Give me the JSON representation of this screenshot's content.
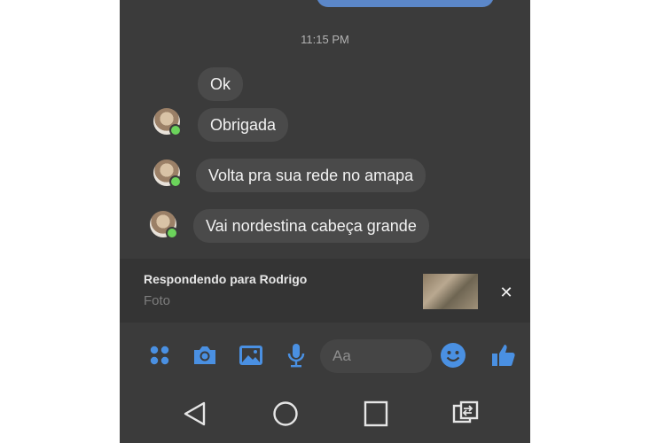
{
  "chat": {
    "timestamp": "11:15 PM",
    "messages": [
      {
        "text": "Ok"
      },
      {
        "text": "Obrigada"
      },
      {
        "text": "Volta pra sua rede no amapa"
      },
      {
        "text": "Vai nordestina cabeça grande"
      }
    ]
  },
  "reply": {
    "title": "Respondendo para Rodrigo",
    "subtitle": "Foto",
    "close_icon": "close-icon"
  },
  "composer": {
    "placeholder": "Aa",
    "icons": [
      "apps-grid-icon",
      "camera-icon",
      "gallery-icon",
      "microphone-icon",
      "emoji-icon",
      "thumbs-up-icon"
    ],
    "accent": "#4a90e2"
  },
  "navbar": {
    "icons": [
      "back-icon",
      "home-icon",
      "recents-icon",
      "switch-icon"
    ]
  }
}
